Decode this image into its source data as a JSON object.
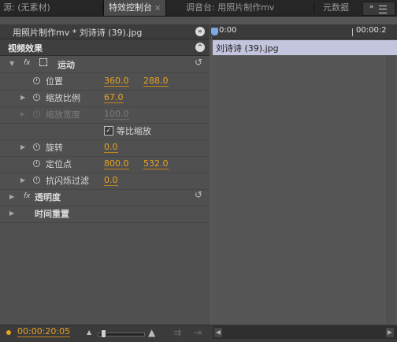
{
  "tabs": [
    {
      "label": "源: (无素材)",
      "active": false
    },
    {
      "label": "特效控制台",
      "active": true,
      "close": "×"
    },
    {
      "label": "调音台: 用照片制作mv",
      "active": false
    },
    {
      "label": "元数据",
      "active": false
    }
  ],
  "panel_menu": {
    "icon": "panel-menu-icon"
  },
  "clip_header": {
    "title": "用照片制作mv * 刘诗诗 (39).jpg"
  },
  "section": {
    "title": "视频效果"
  },
  "effects": {
    "motion": {
      "label": "运动",
      "properties": {
        "position": {
          "label": "位置",
          "x": "360.0",
          "y": "288.0"
        },
        "scale": {
          "label": "缩放比例",
          "value": "67.0"
        },
        "scale_width": {
          "label": "缩放宽度",
          "value": "100.0"
        },
        "uniform_scale": {
          "label": "等比缩放",
          "checked": true
        },
        "rotation": {
          "label": "旋转",
          "value": "0.0"
        },
        "anchor_point": {
          "label": "定位点",
          "x": "800.0",
          "y": "532.0"
        },
        "anti_flicker": {
          "label": "抗闪烁过滤",
          "value": "0.0"
        }
      }
    },
    "opacity": {
      "label": "透明度"
    },
    "time_remapping": {
      "label": "时间重置"
    }
  },
  "timeline": {
    "ruler_start": "0:00",
    "ruler_end": "00:00:2",
    "clip_label": "刘诗诗 (39).jpg"
  },
  "bottom": {
    "timecode": "00:00:20:05"
  },
  "colors": {
    "accent": "#e8a321",
    "playhead": "#cc2a2a",
    "clip_bar": "#c3c4dd"
  }
}
